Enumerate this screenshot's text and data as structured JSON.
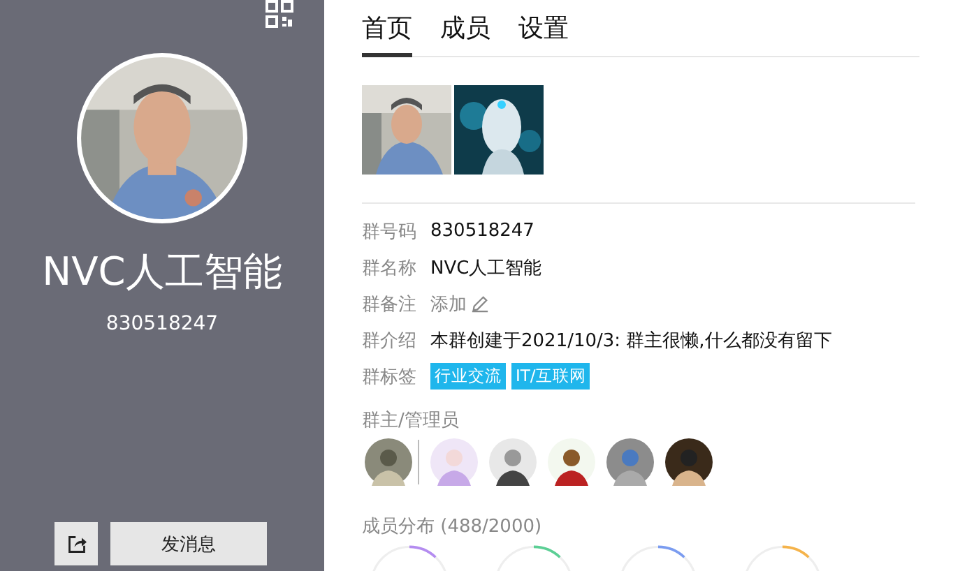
{
  "profile": {
    "name": "NVC人工智能",
    "number": "830518247",
    "buttons": [
      {
        "kind": "share"
      },
      {
        "kind": "text",
        "label": "发消息"
      }
    ]
  },
  "tabs": [
    {
      "label": "首页",
      "selected": true
    },
    {
      "label": "成员",
      "selected": false
    },
    {
      "label": "设置",
      "selected": false
    }
  ],
  "info": [
    {
      "label": "群号码",
      "kind": "text",
      "value": "830518247"
    },
    {
      "label": "群名称",
      "kind": "text",
      "value": "NVC人工智能"
    },
    {
      "label": "群备注",
      "kind": "edit",
      "value": "添加"
    },
    {
      "label": "群介绍",
      "kind": "text",
      "value": "本群创建于2021/10/3:  群主很懒,什么都没有留下"
    },
    {
      "label": "群标签",
      "kind": "tags",
      "tags": [
        "行业交流",
        "IT/互联网"
      ]
    }
  ],
  "admins": {
    "title": "群主/管理员"
  },
  "distribution": {
    "title": "成员分布 (488/2000)",
    "rings": [
      {
        "color": "#b48cf0"
      },
      {
        "color": "#5ccf95"
      },
      {
        "color": "#7b9cf0"
      },
      {
        "color": "#f5b34a"
      }
    ]
  }
}
